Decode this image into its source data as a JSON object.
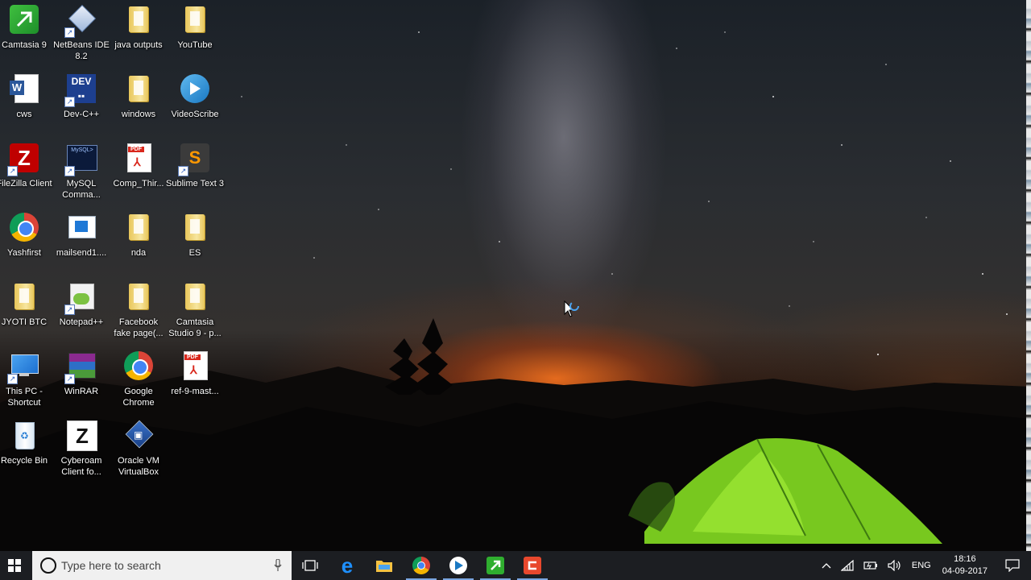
{
  "desktop": {
    "icons": [
      {
        "label": "Camtasia 9",
        "icon": "camtasia-icon"
      },
      {
        "label": "NetBeans IDE 8.2",
        "icon": "netbeans-icon"
      },
      {
        "label": "java outputs",
        "icon": "folder-icon"
      },
      {
        "label": "YouTube",
        "icon": "folder-icon"
      },
      {
        "label": "cws",
        "icon": "word-icon"
      },
      {
        "label": "Dev-C++",
        "icon": "devcpp-icon"
      },
      {
        "label": "windows",
        "icon": "folder-icon"
      },
      {
        "label": "VideoScribe",
        "icon": "videoscribe-icon"
      },
      {
        "label": "FileZilla Client",
        "icon": "filezilla-icon"
      },
      {
        "label": "MySQL Comma...",
        "icon": "mysql-icon"
      },
      {
        "label": "Comp_Thir...",
        "icon": "pdf-icon"
      },
      {
        "label": "Sublime Text 3",
        "icon": "sublime-icon"
      },
      {
        "label": "Yashfirst",
        "icon": "chrome-icon"
      },
      {
        "label": "mailsend1....",
        "icon": "window-icon"
      },
      {
        "label": "nda",
        "icon": "folder-icon"
      },
      {
        "label": "ES",
        "icon": "folder-icon"
      },
      {
        "label": "JYOTI BTC",
        "icon": "folder-icon"
      },
      {
        "label": "Notepad++",
        "icon": "notepadpp-icon"
      },
      {
        "label": "Facebook fake page(...",
        "icon": "folder-icon"
      },
      {
        "label": "Camtasia Studio 9 - p...",
        "icon": "folder-icon"
      },
      {
        "label": "This PC - Shortcut",
        "icon": "this-pc-icon"
      },
      {
        "label": "WinRAR",
        "icon": "winrar-icon"
      },
      {
        "label": "Google Chrome",
        "icon": "chrome-icon"
      },
      {
        "label": "ref-9-mast...",
        "icon": "pdf-icon"
      },
      {
        "label": "Recycle Bin",
        "icon": "recycle-bin-icon"
      },
      {
        "label": "Cyberoam Client fo...",
        "icon": "cyberoam-icon"
      },
      {
        "label": "Oracle VM VirtualBox",
        "icon": "virtualbox-icon"
      }
    ]
  },
  "taskbar": {
    "search_placeholder": "Type here to search",
    "pinned": [
      "edge-icon",
      "file-explorer-icon",
      "chrome-icon",
      "videoscribe-icon",
      "camtasia-icon",
      "camtasia-recorder-icon"
    ],
    "tray": {
      "language": "ENG",
      "time": "18:16",
      "date": "04-09-2017"
    }
  },
  "colors": {
    "taskbar_bg": "#1c1e22",
    "search_bg": "#f0f0f0",
    "tent_green": "#7ed321",
    "horizon_orange": "#ec6e1e"
  }
}
